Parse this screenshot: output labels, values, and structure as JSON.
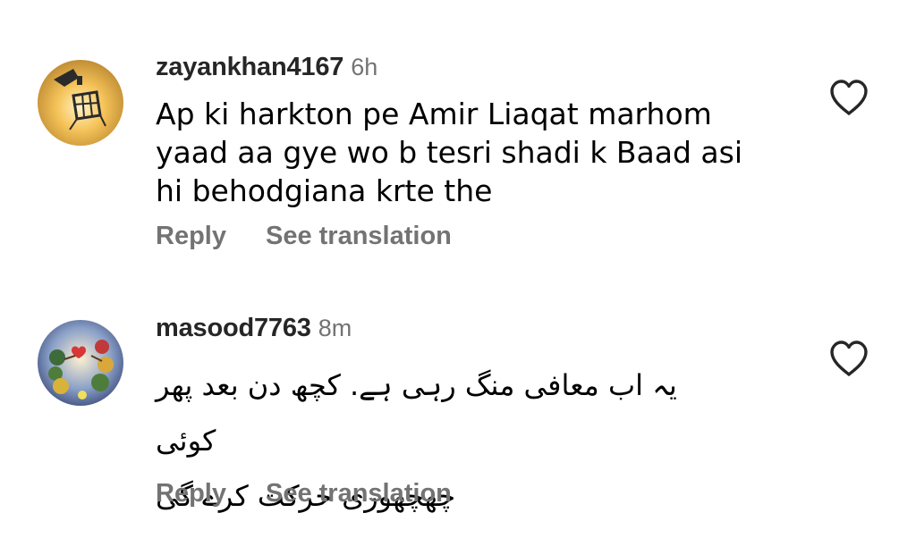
{
  "comments": [
    {
      "username": "zayankhan4167",
      "time": "6h",
      "text_lines": [
        "Ap ki harkton pe Amir Liaqat marhom",
        "yaad aa gye wo b tesri shadi k Baad asi",
        "hi behodgiana krte the"
      ],
      "reply_label": "Reply",
      "translate_label": "See translation",
      "like_icon": "heart-outline-icon"
    },
    {
      "username": "masood7763",
      "time": "8m",
      "text_lines": [
        "یہ اب معافی منگ رہی ہے. کچھ دن بعد پھر کوئی",
        "چھچھوری حرکت کرے گی"
      ],
      "reply_label": "Reply",
      "translate_label": "See translation",
      "like_icon": "heart-outline-icon"
    }
  ]
}
